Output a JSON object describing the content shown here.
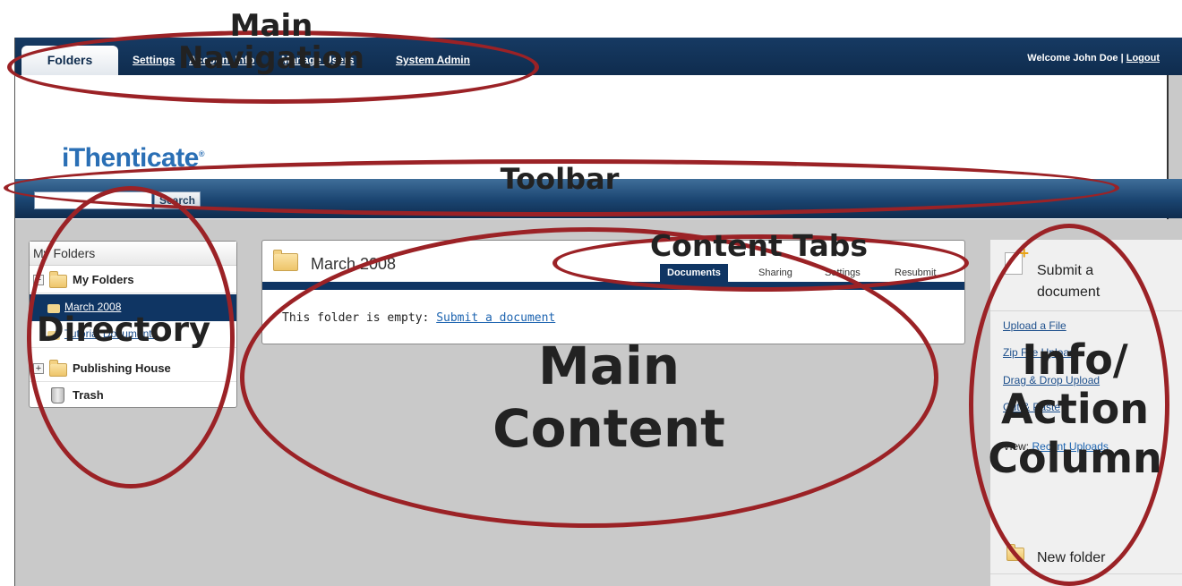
{
  "nav": {
    "active_tab": "Folders",
    "links": [
      "Settings",
      "Account Info",
      "Manage Users",
      "System Admin"
    ],
    "welcome": "Welcome John Doe |",
    "logout": "Logout"
  },
  "logo": {
    "text": "iThenticate",
    "mark": "®"
  },
  "toolbar": {
    "search_value": "",
    "search_button": "Search"
  },
  "directory": {
    "title": "My Folders",
    "root": "My Folders",
    "items": [
      "March 2008",
      "Tutorial Documents",
      "Publishing House",
      "Trash"
    ]
  },
  "main": {
    "folder_title": "March 2008",
    "tabs": [
      "Documents",
      "Sharing",
      "Settings",
      "Resubmit"
    ],
    "active_tab": "Documents",
    "empty_text": "This folder is empty:",
    "empty_link": "Submit a document"
  },
  "actions": {
    "submit_title": "Submit a document",
    "links": [
      "Upload a File",
      "Zip File Upload",
      "Drag & Drop Upload",
      "Cut & Paste"
    ],
    "view_label": "View:",
    "view_link": "Recent Uploads",
    "new_folder": "New folder"
  },
  "annotations": {
    "main_navigation": "Main\nNavigation",
    "toolbar": "Toolbar",
    "content_tabs": "Content Tabs",
    "directory": "Directory",
    "main_content": "Main\nContent",
    "info_action": "Info/\nAction\nColumn"
  },
  "colors": {
    "navy": "#0f2c4e",
    "logo_blue": "#2a6fb5",
    "annotation_red": "#9b2226"
  }
}
